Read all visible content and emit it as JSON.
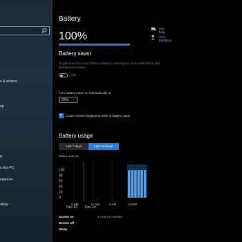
{
  "sidebar": {
    "items": [
      {
        "label": "e & actions"
      },
      {
        "label": "ep"
      },
      {
        "label": "g"
      },
      {
        "label": "o this PC"
      },
      {
        "label": "eriences"
      },
      {
        "label": "sktop"
      }
    ]
  },
  "main": {
    "title": "Battery",
    "percent": "100%",
    "percent_level": 1.0,
    "saver": {
      "heading": "Battery saver",
      "description": "To get more from your battery when it's running low, limit notifications and background activity.",
      "toggle_state": "Off",
      "auto_label": "Turn battery saver on automatically at",
      "auto_value": "20%",
      "brightness_label": "Lower screen brightness while in battery saver"
    },
    "usage": {
      "heading": "Battery usage",
      "tabs": [
        {
          "label": "Last 7 days"
        },
        {
          "label": "Last 24 hours"
        }
      ],
      "screen_on_label": "Screen on",
      "screen_on_value": "4 hours 5 minutes",
      "screen_off_label": "Screen off",
      "screen_off_value": "-",
      "sleep_label": "Sleep",
      "sleep_value": "-"
    }
  },
  "right": {
    "help_label": "Get help",
    "feedback_label": "Give feedback"
  },
  "chart_data": {
    "type": "bar",
    "title": "Battery level (%)",
    "y_ticks": [
      "100",
      "80",
      "60",
      "40",
      "20",
      "0"
    ],
    "ylim": [
      0,
      100
    ],
    "x_ticks": [
      "6 PM",
      "12 AM",
      "6 AM",
      "12 PM"
    ],
    "dates": [
      "Dec 13",
      "Dec 14"
    ],
    "values": [
      100,
      100,
      100,
      100,
      100,
      100
    ],
    "colors": {
      "bar": "#2c7fd4",
      "bar_light": "#5aa0e6"
    }
  }
}
